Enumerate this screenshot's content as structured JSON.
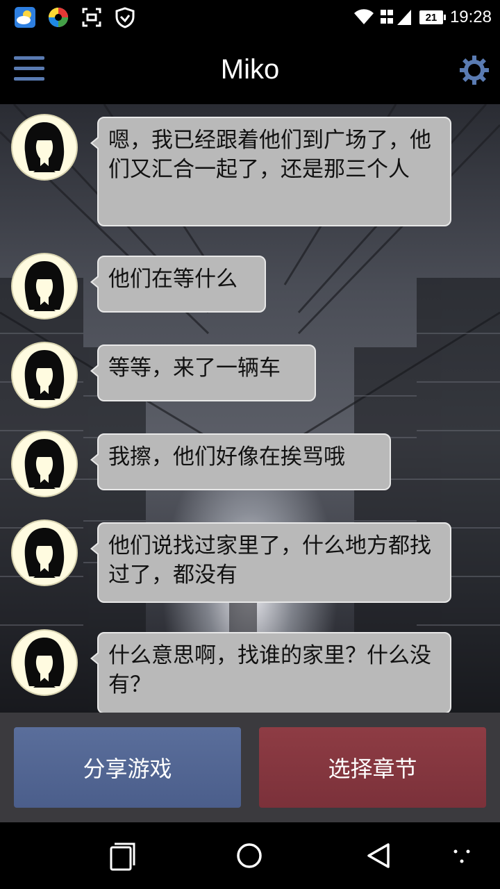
{
  "status_bar": {
    "time": "19:28",
    "battery": "21",
    "icons": [
      "weather-app-icon",
      "colorful-app-icon",
      "scan-icon",
      "shield-icon",
      "wifi-icon",
      "signal-icon"
    ]
  },
  "app_bar": {
    "title": "Miko",
    "menu_icon": "hamburger-menu-icon",
    "settings_icon": "gear-icon"
  },
  "messages": [
    {
      "text": "嗯，我已经跟着他们到广场了，他们又汇合一起了，还是那三个人"
    },
    {
      "text": "他们在等什么"
    },
    {
      "text": "等等，来了一辆车"
    },
    {
      "text": "我擦，他们好像在挨骂哦"
    },
    {
      "text": "他们说找过家里了，什么地方都找过了，都没有"
    },
    {
      "text": "什么意思啊，找谁的家里？什么没有？"
    }
  ],
  "buttons": {
    "share": "分享游戏",
    "chapter": "选择章节"
  },
  "colors": {
    "share_button": "#53668f",
    "chapter_button": "#843741",
    "bubble": "#b9b9b9",
    "accent": "#5a7bb2"
  },
  "nav_bar": {
    "icons": [
      "recent-apps-icon",
      "home-icon",
      "back-icon",
      "assist-icon"
    ]
  }
}
